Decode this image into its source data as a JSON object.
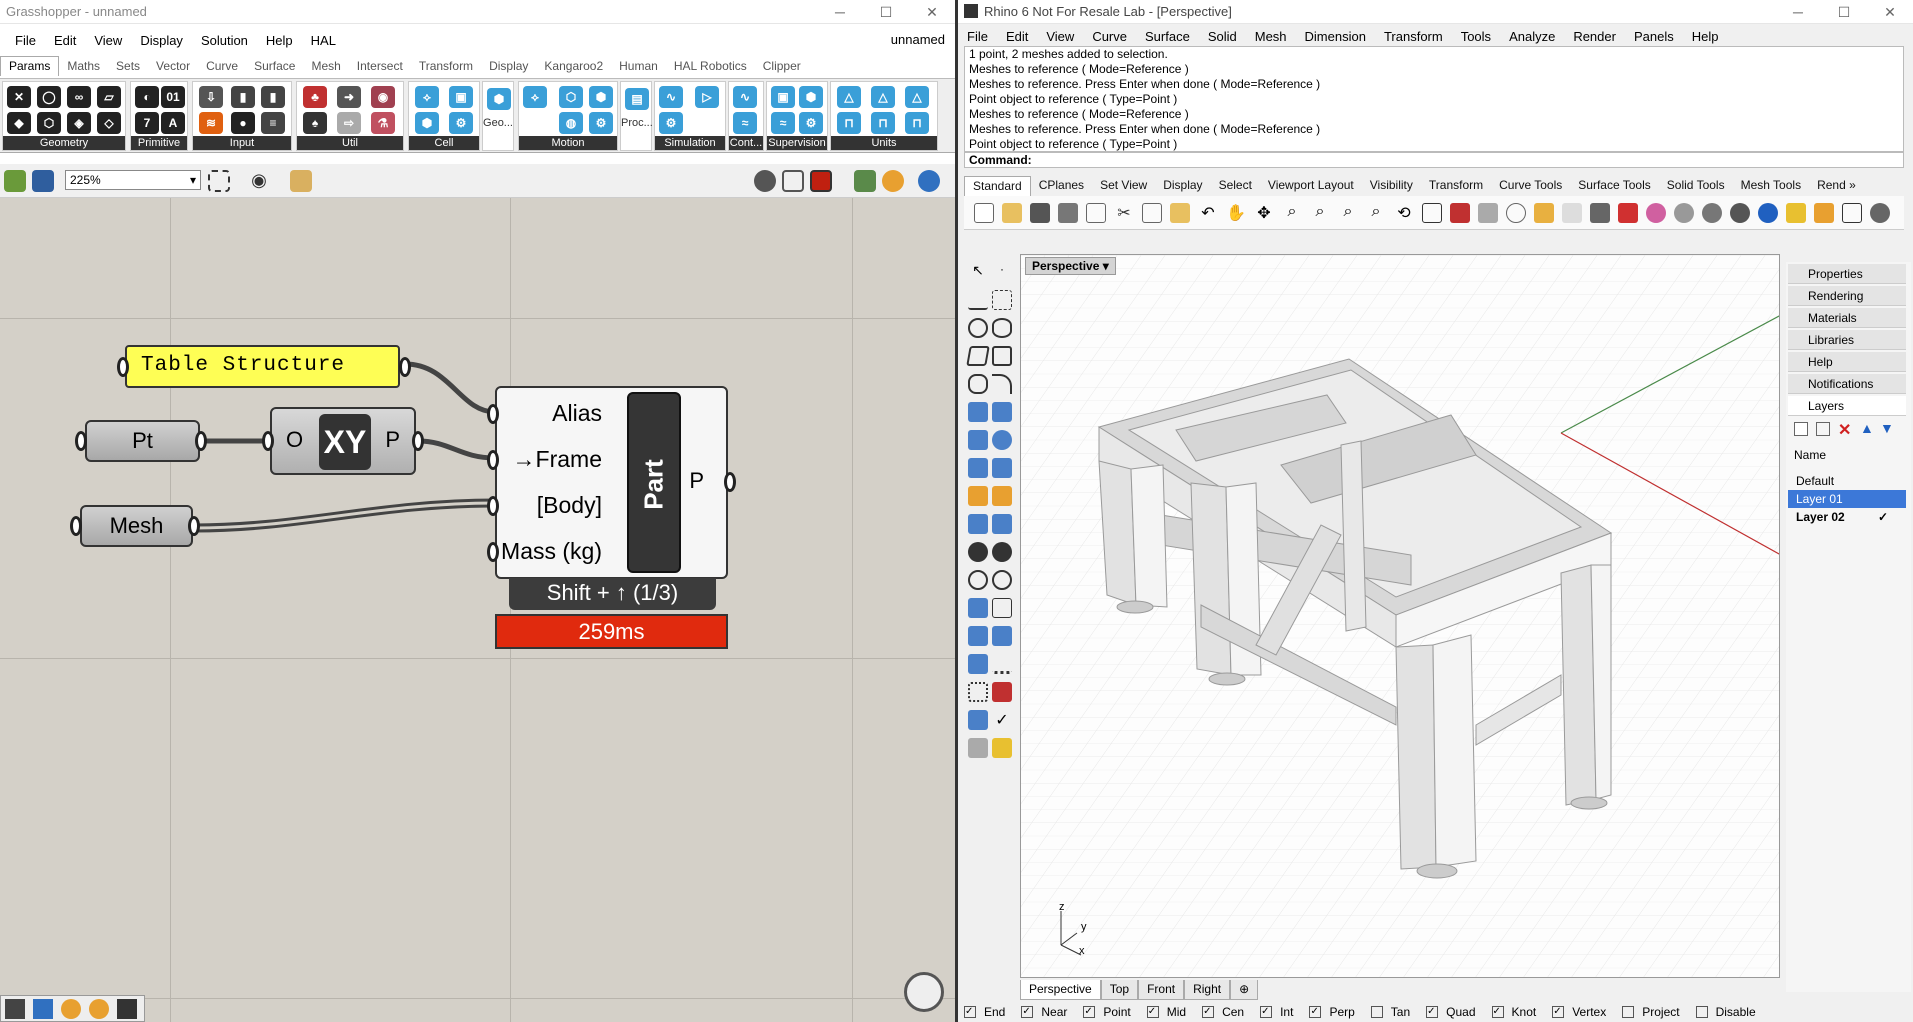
{
  "grasshopper": {
    "title": "Grasshopper - unnamed",
    "doc_name": "unnamed",
    "menu": [
      "File",
      "Edit",
      "View",
      "Display",
      "Solution",
      "Help",
      "HAL"
    ],
    "tabs": [
      "Params",
      "Maths",
      "Sets",
      "Vector",
      "Curve",
      "Surface",
      "Mesh",
      "Intersect",
      "Transform",
      "Display",
      "Kangaroo2",
      "Human",
      "HAL Robotics",
      "Clipper"
    ],
    "active_tab": "Params",
    "ribbon_groups": [
      "Geometry",
      "Primitive",
      "Input",
      "Util",
      "Cell",
      "Geo...",
      "Motion",
      "Proc...",
      "Simulation",
      "Cont...",
      "Supervision",
      "Units"
    ],
    "zoom": "225%",
    "canvas": {
      "panel_text": "Table Structure",
      "pt_label": "Pt",
      "mesh_label": "Mesh",
      "xy_label": "XY",
      "xy_in": "O",
      "xy_out": "P",
      "component_inputs": [
        "Alias",
        "→Frame",
        "[Body]",
        "Mass (kg)"
      ],
      "component_name": "Part",
      "component_output": "P",
      "shift_hint": "Shift + ↑ (1/3)",
      "timer": "259ms"
    }
  },
  "rhino": {
    "title": "Rhino 6 Not For Resale Lab - [Perspective]",
    "menu": [
      "File",
      "Edit",
      "View",
      "Curve",
      "Surface",
      "Solid",
      "Mesh",
      "Dimension",
      "Transform",
      "Tools",
      "Analyze",
      "Render",
      "Panels",
      "Help"
    ],
    "history": [
      "1 point, 2 meshes added to selection.",
      "Meshes to reference ( Mode=Reference )",
      "Meshes to reference. Press Enter when done ( Mode=Reference )",
      "Point object to reference ( Type=Point )",
      "Meshes to reference ( Mode=Reference )",
      "Meshes to reference. Press Enter when done ( Mode=Reference )",
      "Point object to reference ( Type=Point )"
    ],
    "command_label": "Command:",
    "toolbar_tabs": [
      "Standard",
      "CPlanes",
      "Set View",
      "Display",
      "Select",
      "Viewport Layout",
      "Visibility",
      "Transform",
      "Curve Tools",
      "Surface Tools",
      "Solid Tools",
      "Mesh Tools",
      "Rend »"
    ],
    "viewport_title": "Perspective",
    "viewport_tabs": [
      "Perspective",
      "Top",
      "Front",
      "Right"
    ],
    "axis": {
      "x": "x",
      "y": "y",
      "z": "z"
    },
    "side_panels": [
      "Properties",
      "Rendering",
      "Materials",
      "Libraries",
      "Help",
      "Notifications",
      "Layers"
    ],
    "layers_header": "Name",
    "layers": [
      {
        "name": "Default",
        "current": false,
        "selected": false
      },
      {
        "name": "Layer 01",
        "current": false,
        "selected": true
      },
      {
        "name": "Layer 02",
        "current": true,
        "selected": false
      }
    ],
    "osnaps": [
      {
        "label": "End",
        "on": true
      },
      {
        "label": "Near",
        "on": true
      },
      {
        "label": "Point",
        "on": true
      },
      {
        "label": "Mid",
        "on": true
      },
      {
        "label": "Cen",
        "on": true
      },
      {
        "label": "Int",
        "on": true
      },
      {
        "label": "Perp",
        "on": true
      },
      {
        "label": "Tan",
        "on": false
      },
      {
        "label": "Quad",
        "on": true
      },
      {
        "label": "Knot",
        "on": true
      },
      {
        "label": "Vertex",
        "on": true
      },
      {
        "label": "Project",
        "on": false
      },
      {
        "label": "Disable",
        "on": false
      }
    ]
  },
  "colors": {
    "panel_yellow": "#fefe55",
    "timer_red": "#e02a0e",
    "selection_blue": "#3c78d8",
    "canvas_bg": "#d4d0c8"
  }
}
